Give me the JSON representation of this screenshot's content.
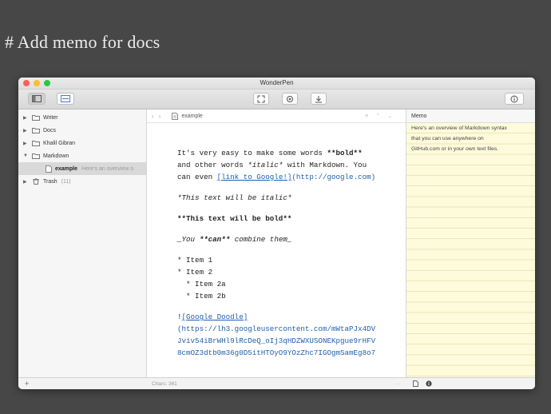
{
  "slide": {
    "title": "# Add memo for docs"
  },
  "window": {
    "title": "WonderPen"
  },
  "sidebar": {
    "items": [
      {
        "label": "Writer",
        "type": "folder",
        "expanded": false
      },
      {
        "label": "Docs",
        "type": "folder",
        "expanded": false
      },
      {
        "label": "Khalil Gibran",
        "type": "folder",
        "expanded": false
      },
      {
        "label": "Markdown",
        "type": "folder",
        "expanded": true
      },
      {
        "label": "example",
        "preview": "Here's an overview o",
        "type": "document",
        "selected": true
      },
      {
        "label": "Trash",
        "count": "(11)",
        "type": "trash",
        "expanded": false
      }
    ]
  },
  "editor": {
    "doc_title": "example",
    "lines": {
      "l1a": "It's very easy to make some words ",
      "l1b": "**bold**",
      "l2a": "and other words ",
      "l2b": "*italic*",
      "l2c": " with Markdown. You",
      "l3a": "can even ",
      "l3b": "[link to Google!]",
      "l3c": "(http://google.com)",
      "l4": "*This text will be italic*",
      "l5": "**This text will be bold**",
      "l6a": "_You ",
      "l6b": "**can**",
      "l6c": " combine them_",
      "l7": "* Item 1",
      "l8": "* Item 2",
      "l9": "  * Item 2a",
      "l10": "  * Item 2b",
      "l11a": "!",
      "l11b": "[Google Doodle]",
      "l12": "(https://lh3.googleusercontent.com/mWtaPJx4DV",
      "l13": "Jviv54iBrWHl9lRcDeQ_oIj3qHDZWXUSONEKpgue9rHFV",
      "l14": "8cmOZ3dtb0m36g0D5itHTOyO9YOzZhc7IGOgmSamEg8o7"
    }
  },
  "memo": {
    "header": "Memo",
    "lines": [
      "Here's an overview of Markdown syntax",
      "that you can use anywhere on",
      "GitHub.com or in your own text files."
    ]
  },
  "status": {
    "add": "+",
    "chars": "Chars: 361",
    "more": "···"
  },
  "colors": {
    "background": "#474747",
    "memo_paper": "#fdfbdc",
    "link": "#1f5fb0",
    "selection": "#d9d9d9"
  },
  "icons": [
    "sidebar-toggle-icon",
    "panel-toggle-icon",
    "fullscreen-icon",
    "target-icon",
    "export-icon",
    "info-icon",
    "folder-icon",
    "document-icon",
    "trash-icon",
    "memo-doc-icon",
    "memo-info-icon"
  ]
}
